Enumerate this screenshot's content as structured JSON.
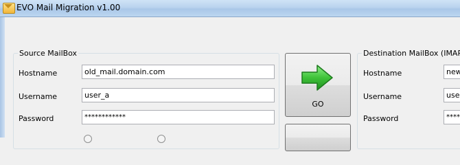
{
  "window": {
    "title": "EVO Mail Migration v1.00"
  },
  "source": {
    "group_title": "Source MailBox",
    "hostname_label": "Hostname",
    "hostname_value": "old_mail.domain.com",
    "username_label": "Username",
    "username_value": "user_a",
    "password_label": "Password",
    "password_value": "************"
  },
  "go_button": {
    "label": "GO",
    "icon": "green-right-arrow-icon"
  },
  "destination": {
    "group_title": "Destination MailBox (IMAP",
    "hostname_label": "Hostname",
    "hostname_value": "new",
    "username_label": "Username",
    "username_value": "user",
    "password_label": "Password",
    "password_value": "****"
  }
}
